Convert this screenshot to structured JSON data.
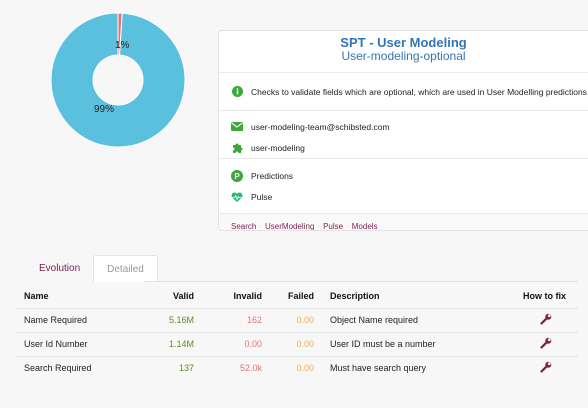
{
  "chart_data": {
    "type": "pie",
    "slices": [
      {
        "label": "1%",
        "value": 1,
        "color": "#e57373"
      },
      {
        "label": "99%",
        "value": 99,
        "color": "#5bc0de"
      }
    ]
  },
  "card": {
    "title": "SPT - User Modeling",
    "subtitle": "User-modeling-optional",
    "description": "Checks to validate fields which are optional, which are used in User Modelling predictions",
    "email": "user-modeling-team@schibsted.com",
    "team": "user-modeling",
    "predictions": "Predictions",
    "pulse": "Pulse",
    "breadcrumbs": [
      "Search",
      "UserModeling",
      "Pulse",
      "Models"
    ],
    "breadcrumb_sep": "·"
  },
  "tabs": {
    "evolution": "Evolution",
    "detailed": "Detailed"
  },
  "table": {
    "headers": {
      "name": "Name",
      "valid": "Valid",
      "invalid": "Invalid",
      "failed": "Failed",
      "description": "Description",
      "how_to_fix": "How to fix"
    },
    "rows": [
      {
        "name": "Name Required",
        "valid": "5.16M",
        "invalid": "162",
        "failed": "0.00",
        "description": "Object Name required"
      },
      {
        "name": "User Id Number",
        "valid": "1.14M",
        "invalid": "0.00",
        "failed": "0.00",
        "description": "User ID must be a number"
      },
      {
        "name": "Search Required",
        "valid": "137",
        "invalid": "52.0k",
        "failed": "0.00",
        "description": "Must have search query"
      }
    ]
  },
  "colors": {
    "accent": "#3375b4",
    "link": "#7a1f4c",
    "icon_green": "#3aa83a",
    "heart": "#2bb673",
    "wrench": "#7a1f4c"
  },
  "icons": [
    "info-icon",
    "envelope-icon",
    "puzzle-icon",
    "predictions-icon",
    "heartbeat-icon",
    "wrench-icon"
  ]
}
